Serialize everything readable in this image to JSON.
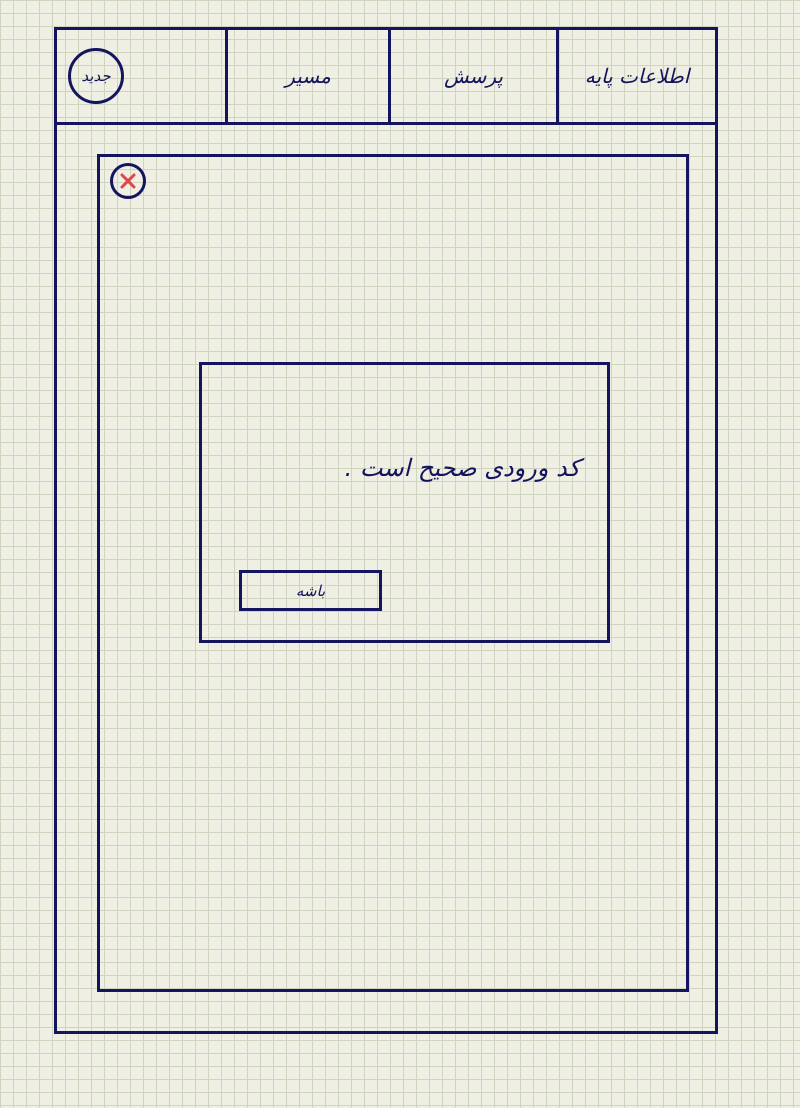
{
  "header": {
    "logo_text": "جدید",
    "nav_items": [
      {
        "label": "اطلاعات پایه"
      },
      {
        "label": "پرسش"
      },
      {
        "label": "مسیر"
      }
    ]
  },
  "dialog": {
    "message": "کد ورودی صحیح است .",
    "ok_label": "باشه"
  },
  "icons": {
    "close": "close-icon"
  },
  "colors": {
    "ink": "#15155f",
    "close_x": "#e0474c",
    "paper": "#efefe3",
    "grid": "#cfd4bf"
  }
}
